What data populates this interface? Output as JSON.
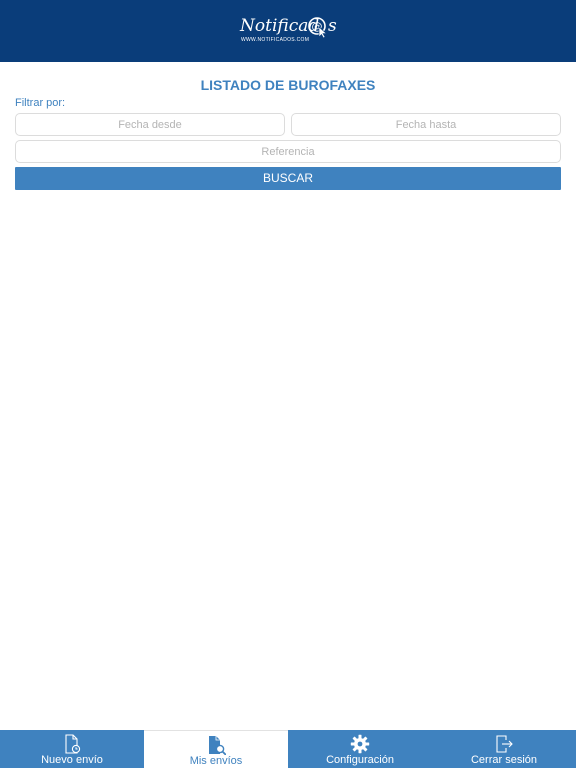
{
  "header": {
    "logo_main": "Notificad",
    "logo_tail": "s",
    "logo_sub": "WWW.NOTIFICADOS.COM"
  },
  "page": {
    "title": "LISTADO DE BUROFAXES",
    "filter_label": "Filtrar por:"
  },
  "filters": {
    "fecha_desde_placeholder": "Fecha desde",
    "fecha_hasta_placeholder": "Fecha hasta",
    "referencia_placeholder": "Referencia",
    "fecha_desde_value": "",
    "fecha_hasta_value": "",
    "referencia_value": ""
  },
  "search_button_label": "BUSCAR",
  "tabs": [
    {
      "label": "Nuevo envío",
      "icon": "new-document-icon",
      "active": false
    },
    {
      "label": "Mis envíos",
      "icon": "search-document-icon",
      "active": true
    },
    {
      "label": "Configuración",
      "icon": "gear-icon",
      "active": false
    },
    {
      "label": "Cerrar sesión",
      "icon": "logout-icon",
      "active": false
    }
  ],
  "colors": {
    "header_bg": "#0a3d7a",
    "accent": "#3f82bf",
    "tab_active_bg": "#ffffff"
  }
}
